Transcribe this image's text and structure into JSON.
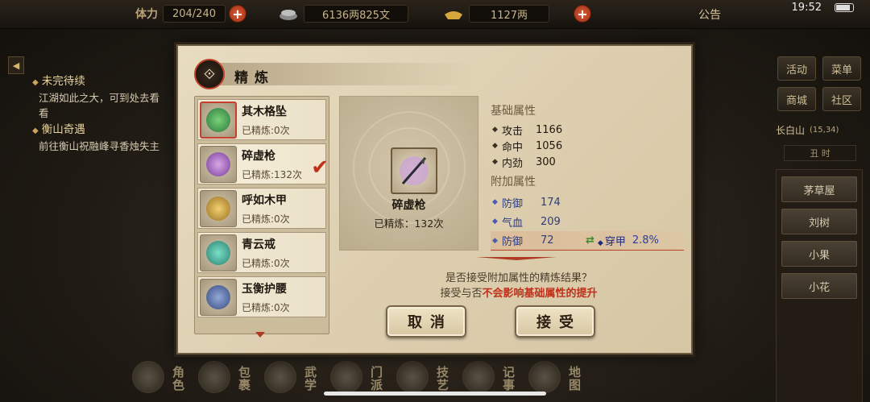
{
  "topbar": {
    "stamina_label": "体力",
    "stamina_value": "204/240",
    "money_value": "6136两825文",
    "gold_value": "1127两",
    "notice_label": "公告",
    "clock": "19:52"
  },
  "quests": [
    {
      "title": "未完待续",
      "desc": "江湖如此之大，可到处去看看"
    },
    {
      "title": "衡山奇遇",
      "desc": "前往衡山祝融峰寻香烛失主"
    }
  ],
  "right_panel": {
    "buttons": [
      "活动",
      "菜单",
      "商城",
      "社区"
    ],
    "location": "长白山",
    "coord": "(15,34)",
    "time_slot": "丑 时",
    "npcs": [
      "茅草屋",
      "刘树",
      "小果",
      "小花"
    ]
  },
  "bottom_nav": [
    "角色",
    "包裹",
    "武学",
    "门派",
    "技艺",
    "记事",
    "地图"
  ],
  "dialog": {
    "title": "精炼",
    "items": [
      {
        "name": "其木格坠",
        "refine": "已精炼:0次",
        "color": "#3a9a4a"
      },
      {
        "name": "碎虚枪",
        "refine": "已精炼:132次",
        "color": "#9a5ab0"
      },
      {
        "name": "呼如木甲",
        "refine": "已精炼:0次",
        "color": "#c9a030"
      },
      {
        "name": "青云戒",
        "refine": "已精炼:0次",
        "color": "#3aa090"
      },
      {
        "name": "玉衡护腰",
        "refine": "已精炼:0次",
        "color": "#506090"
      }
    ],
    "preview": {
      "name": "碎虚枪",
      "refine": "已精炼：132次"
    },
    "base_header": "基础属性",
    "base_stats": [
      {
        "k": "攻击",
        "v": "1166"
      },
      {
        "k": "命中",
        "v": "1056"
      },
      {
        "k": "内劲",
        "v": "300"
      }
    ],
    "extra_header": "附加属性",
    "extra_stats": [
      {
        "k": "防御",
        "v": "174"
      },
      {
        "k": "气血",
        "v": "209"
      },
      {
        "k": "防御",
        "v": "72"
      }
    ],
    "bonus": {
      "k": "穿甲",
      "v": "2.8%"
    },
    "prompt1": "是否接受附加属性的精炼结果？",
    "prompt2_a": "接受与否",
    "prompt2_b": "不会影响基础属性的提升",
    "cancel_label": "取消",
    "accept_label": "接受"
  }
}
